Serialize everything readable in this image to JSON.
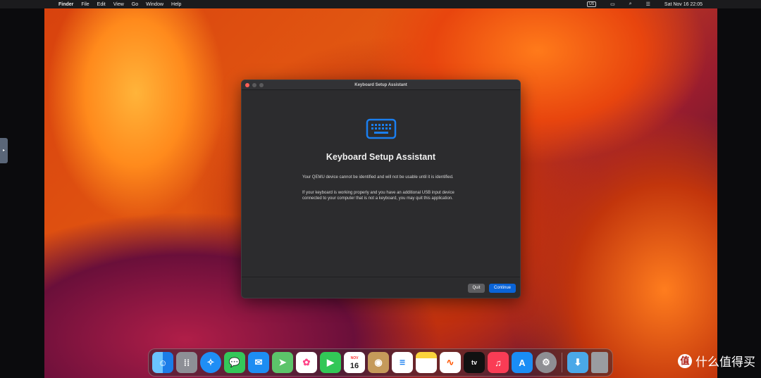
{
  "menubar": {
    "apple": "",
    "app": "Finder",
    "items": [
      "File",
      "Edit",
      "View",
      "Go",
      "Window",
      "Help"
    ],
    "input_source": "US",
    "datetime": "Sat Nov 16  22:05"
  },
  "window": {
    "title": "Keyboard Setup Assistant",
    "heading": "Keyboard Setup Assistant",
    "paragraph1": "Your QEMU device cannot be identified and will not be usable until it is identified.",
    "paragraph2": "If your keyboard is working properly and you have an additional USB input device connected to your computer that is not a keyboard, you may quit this application.",
    "quit_label": "Quit",
    "continue_label": "Continue"
  },
  "dock": {
    "calendar_month": "NOV",
    "calendar_day": "16",
    "tv_label": "tv"
  },
  "watermark": {
    "logo": "值",
    "text": "什么值得买"
  }
}
